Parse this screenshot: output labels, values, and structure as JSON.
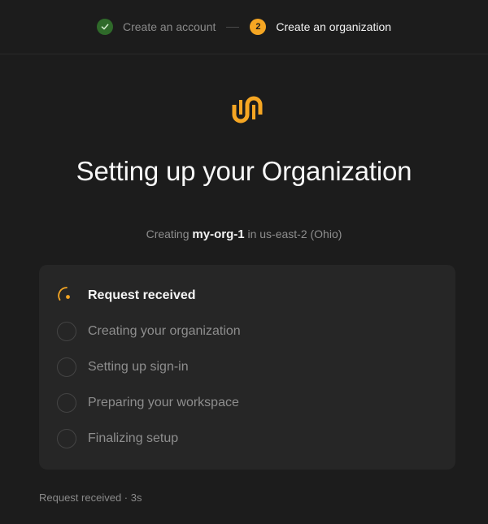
{
  "stepper": {
    "step1_label": "Create an account",
    "step1_status": "complete",
    "step2_number": "2",
    "step2_label": "Create an organization"
  },
  "logo": {
    "icon": "brand-logo-icon",
    "color": "#f5a623"
  },
  "title": "Setting up your Organization",
  "subtitle": {
    "prefix": "Creating",
    "org_name": "my-org-1",
    "suffix": "in us-east-2 (Ohio)"
  },
  "progress": {
    "items": [
      {
        "label": "Request received",
        "status": "in-progress"
      },
      {
        "label": "Creating your organization",
        "status": "pending"
      },
      {
        "label": "Setting up sign-in",
        "status": "pending"
      },
      {
        "label": "Preparing your workspace",
        "status": "pending"
      },
      {
        "label": "Finalizing setup",
        "status": "pending"
      }
    ]
  },
  "footer": {
    "status_text": "Request received · 3s"
  },
  "colors": {
    "accent": "#f5a623",
    "success": "#2f6a2a",
    "background": "#1c1c1c",
    "card": "#262626"
  }
}
